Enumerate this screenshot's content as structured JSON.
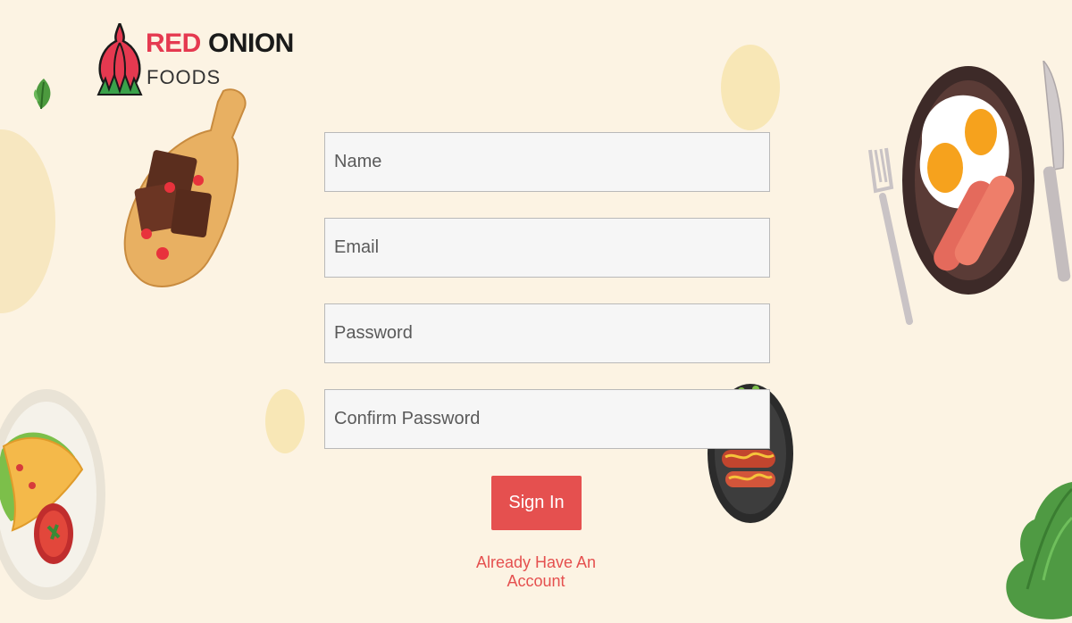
{
  "brand": {
    "name_red": "RED",
    "name_dark": "ONION",
    "tagline": "FOODS",
    "color_red": "#e53950",
    "color_dark": "#1a1a1a"
  },
  "form": {
    "name_placeholder": "Name",
    "email_placeholder": "Email",
    "password_placeholder": "Password",
    "confirm_password_placeholder": "Confirm Password"
  },
  "actions": {
    "signin_label": "Sign In",
    "account_link_label": "Already Have An Account",
    "accent_color": "#e5504f"
  },
  "background_color": "#fcf3e3",
  "decorations": [
    "onion-logo-icon",
    "brownie-board-illustration",
    "eggs-sausage-plate-illustration",
    "fork-icon",
    "knife-icon",
    "taco-plate-illustration",
    "sausage-pan-illustration",
    "lettuce-leaf-illustration",
    "herb-leaf-illustration"
  ]
}
